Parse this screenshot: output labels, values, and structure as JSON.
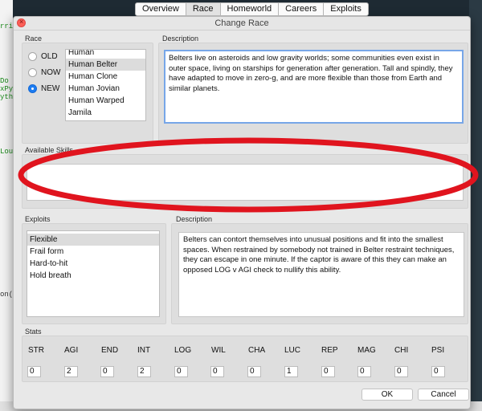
{
  "background": {
    "code_lines": [
      "rris",
      "Do",
      "xPy",
      "yth",
      "Lou",
      "on("
    ]
  },
  "tabs": [
    "Overview",
    "Race",
    "Homeworld",
    "Careers",
    "Exploits"
  ],
  "active_tab": "Race",
  "dialog": {
    "title": "Change Race",
    "race": {
      "label": "Race",
      "options": [
        "OLD",
        "NOW",
        "NEW"
      ],
      "selected_option": "NEW",
      "list": [
        "Human",
        "Human Belter",
        "Human Clone",
        "Human Jovian",
        "Human Warped",
        "Jamila"
      ],
      "selected": "Human Belter"
    },
    "description": {
      "label": "Description",
      "text": "Belters live on asteroids and low gravity worlds; some communities even exist in outer space, living on starships for generation after generation. Tall and spindly, they have adapted to move in zero-g, and are more flexible than those from Earth and similar planets."
    },
    "skills": {
      "label": "Available Skills",
      "value": ""
    },
    "exploits": {
      "label": "Exploits",
      "list": [
        "Flexible",
        "Frail form",
        "Hard-to-hit",
        "Hold breath"
      ],
      "selected": "Flexible"
    },
    "exploit_description": {
      "label": "Description",
      "text": "Belters can contort themselves into unusual positions and fit into the smallest spaces. When restrained by somebody not trained in Belter restraint techniques, they can escape in one minute. If the captor is aware of this they can make an opposed LOG v AGI check to nullify this ability."
    },
    "stats": {
      "label": "Stats",
      "items": [
        {
          "name": "STR",
          "value": "0"
        },
        {
          "name": "AGI",
          "value": "2"
        },
        {
          "name": "END",
          "value": "0"
        },
        {
          "name": "INT",
          "value": "2"
        },
        {
          "name": "LOG",
          "value": "0"
        },
        {
          "name": "WIL",
          "value": "0"
        },
        {
          "name": "CHA",
          "value": "0"
        },
        {
          "name": "LUC",
          "value": "1"
        },
        {
          "name": "REP",
          "value": "0"
        },
        {
          "name": "MAG",
          "value": "0"
        },
        {
          "name": "CHI",
          "value": "0"
        },
        {
          "name": "PSI",
          "value": "0"
        }
      ]
    },
    "buttons": {
      "ok": "OK",
      "cancel": "Cancel"
    }
  },
  "colors": {
    "accent": "#1c7cf2",
    "annotation": "#e0141e",
    "dialog_bg": "#e8e8e8"
  }
}
